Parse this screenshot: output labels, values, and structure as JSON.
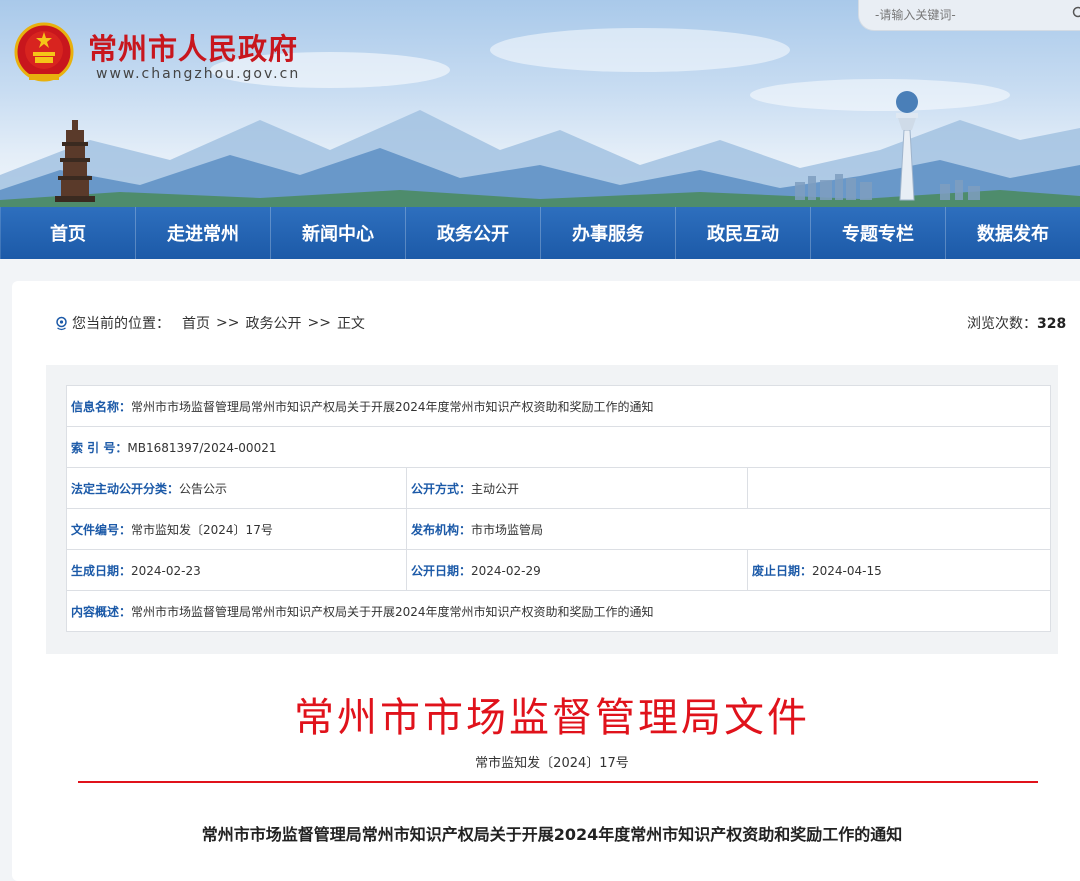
{
  "header": {
    "site_title": "常州市人民政府",
    "site_url": "www.changzhou.gov.cn",
    "search_placeholder": "-请输入关键词-"
  },
  "nav": [
    {
      "label": "首页"
    },
    {
      "label": "走进常州"
    },
    {
      "label": "新闻中心"
    },
    {
      "label": "政务公开"
    },
    {
      "label": "办事服务"
    },
    {
      "label": "政民互动"
    },
    {
      "label": "专题专栏"
    },
    {
      "label": "数据发布"
    }
  ],
  "breadcrumb": {
    "prefix": "您当前的位置：",
    "items": [
      "首页",
      "政务公开",
      "正文"
    ],
    "separator": ">>"
  },
  "views": {
    "label": "浏览次数：",
    "count": "328"
  },
  "info": {
    "name_label": "信息名称：",
    "name_value": "常州市市场监督管理局常州市知识产权局关于开展2024年度常州市知识产权资助和奖励工作的通知",
    "index_label": "索 引 号：",
    "index_value": "MB1681397/2024-00021",
    "category_label": "法定主动公开分类：",
    "category_value": "公告公示",
    "method_label": "公开方式：",
    "method_value": "主动公开",
    "doc_no_label": "文件编号：",
    "doc_no_value": "常市监知发〔2024〕17号",
    "publisher_label": "发布机构：",
    "publisher_value": "市市场监管局",
    "created_label": "生成日期：",
    "created_value": "2024-02-23",
    "published_label": "公开日期：",
    "published_value": "2024-02-29",
    "expire_label": "废止日期：",
    "expire_value": "2024-04-15",
    "summary_label": "内容概述：",
    "summary_value": "常州市市场监督管理局常州市知识产权局关于开展2024年度常州市知识产权资助和奖励工作的通知"
  },
  "document": {
    "org_header": "常州市市场监督管理局文件",
    "doc_number": "常市监知发〔2024〕17号",
    "title": "常州市市场监督管理局常州市知识产权局关于开展2024年度常州市知识产权资助和奖励工作的通知"
  },
  "colors": {
    "brand_red": "#e0121b",
    "nav_blue": "#1c5aa8",
    "label_blue": "#1c5aa8"
  }
}
